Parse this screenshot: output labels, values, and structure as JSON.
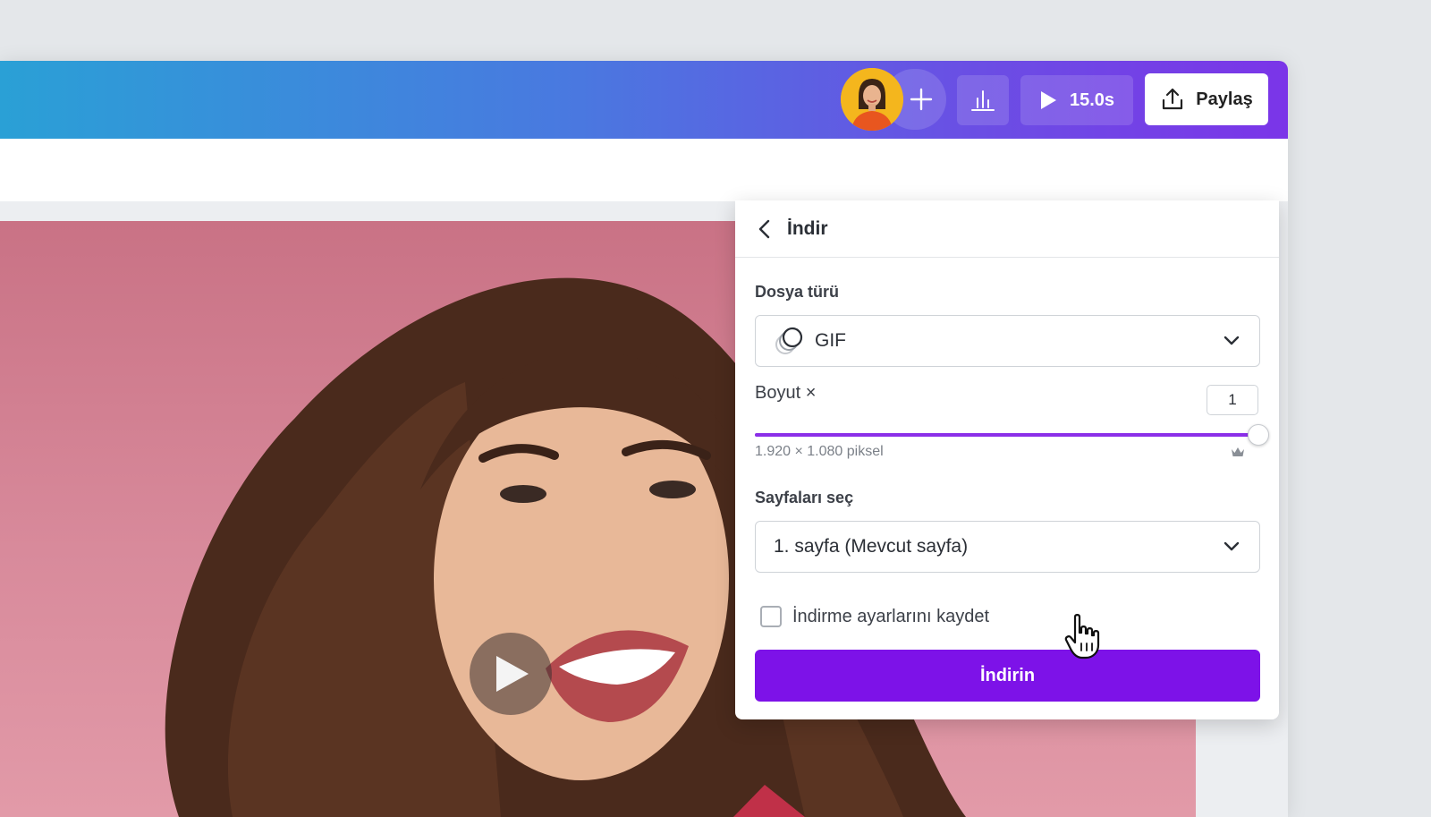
{
  "topbar": {
    "play_duration": "15.0s",
    "share_label": "Paylaş",
    "gradient_start": "#2aa0d6",
    "gradient_end": "#7b35e8"
  },
  "download_panel": {
    "title": "İndir",
    "file_type_label": "Dosya türü",
    "file_type_value": "GIF",
    "size_label": "Boyut ×",
    "size_value": "1",
    "size_slider_fraction": 1.0,
    "dimensions": "1.920 × 1.080 piksel",
    "pages_label": "Sayfaları seç",
    "pages_value": "1. sayfa (Mevcut sayfa)",
    "save_settings_label": "İndirme ayarlarını kaydet",
    "save_settings_checked": false,
    "download_button_label": "İndirin",
    "accent_color": "#7d12e8"
  }
}
